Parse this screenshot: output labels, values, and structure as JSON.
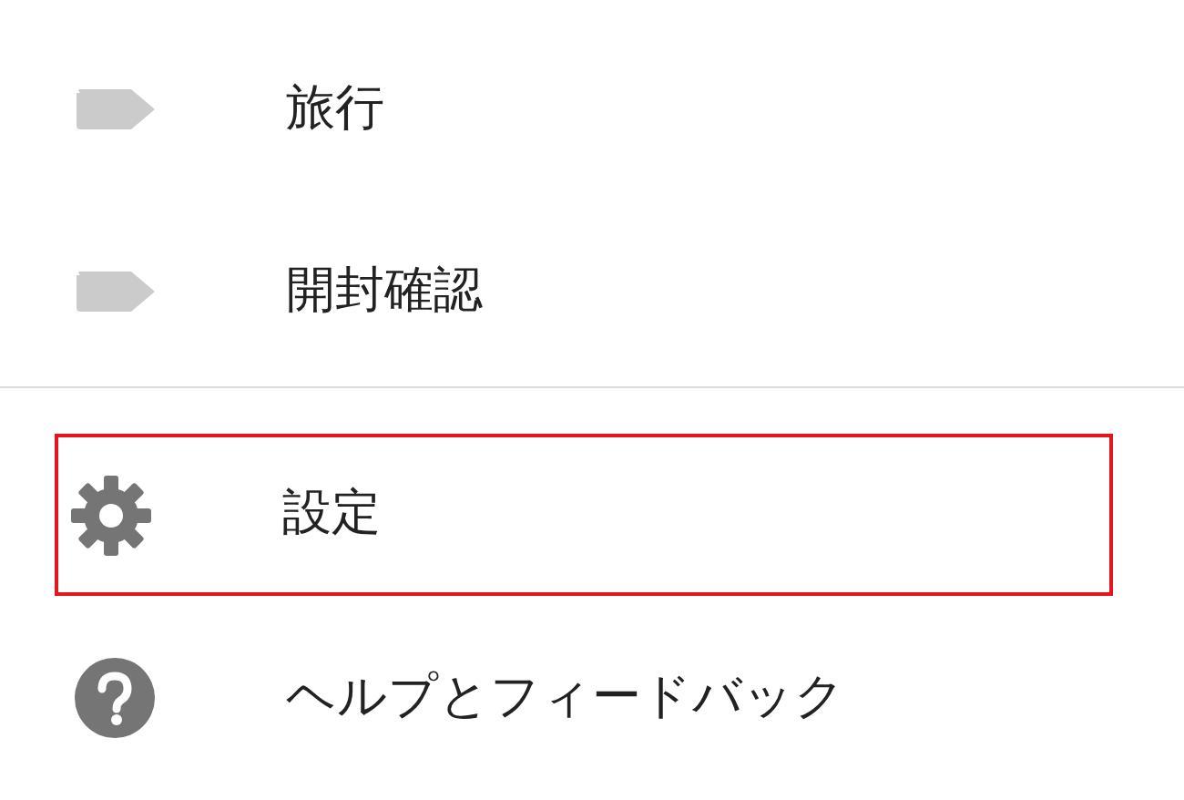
{
  "menu": {
    "sections": [
      {
        "items": [
          {
            "kind": "label",
            "label": "旅行",
            "highlighted": false
          },
          {
            "kind": "label",
            "label": "開封確認",
            "highlighted": false
          }
        ]
      },
      {
        "items": [
          {
            "kind": "settings",
            "label": "設定",
            "highlighted": true
          },
          {
            "kind": "help",
            "label": "ヘルプとフィードバック",
            "highlighted": false
          }
        ]
      }
    ]
  }
}
